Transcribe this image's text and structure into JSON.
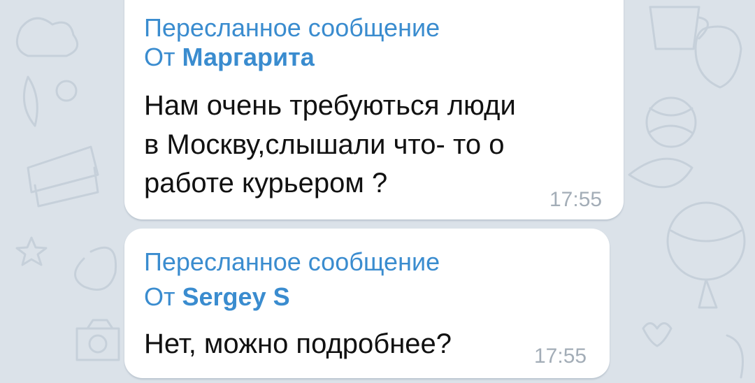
{
  "chat": {
    "messages": [
      {
        "forward_label": "Пересланное сообщение",
        "from_prefix": "От",
        "from_name": "Маргарита",
        "text_lines": [
          "Нам очень требуються люди",
          "в Москву,слышали что- то о",
          "работе курьером ?"
        ],
        "time": "17:55"
      },
      {
        "forward_label": "Пересланное сообщение",
        "from_prefix": "От",
        "from_name": "Sergey S",
        "text_lines": [
          "Нет, можно подробнее?"
        ],
        "time": "17:55"
      }
    ]
  },
  "colors": {
    "background": "#dbe2e9",
    "bubble": "#ffffff",
    "forward_accent": "#3a8ccf",
    "time": "#a3adb7",
    "text": "#111111"
  }
}
